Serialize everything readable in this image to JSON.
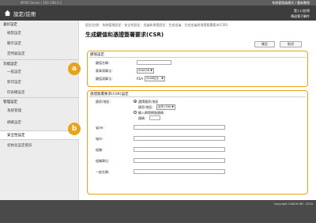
{
  "topbar": {
    "host": "MF00 Series / 192.168.0.1",
    "user": "系統管理員模式 / 重新整理"
  },
  "header": {
    "title": "設定/註冊",
    "logout": "登入口註冊",
    "mail": "傳送電子郵件"
  },
  "sidebar": {
    "items": [
      {
        "label": "喜好設定"
      },
      {
        "label": "紙張設定"
      },
      {
        "label": "顯示設定"
      },
      {
        "label": "定時器設定"
      },
      {
        "label": "功能設定"
      },
      {
        "label": "一般設定"
      },
      {
        "label": "影印設定"
      },
      {
        "label": "印表機設定"
      },
      {
        "label": "管理設定"
      },
      {
        "label": "系統管理"
      },
      {
        "label": "網路設定"
      },
      {
        "label": "安全性設定"
      },
      {
        "label": "初始化設定資訊"
      }
    ]
  },
  "main": {
    "breadcrumb": "設定/註冊：系統管理設定：安全性設定：金鑰和憑證設定：生成金鑰：生成金鑰與憑證簽署要求(CSR)",
    "title": "生成鍵值和憑證簽署要求(CSR)",
    "ok_label": "確定",
    "cancel_label": "取消"
  },
  "key_section": {
    "title": "鍵值設定",
    "name_label": "鍵值名稱：",
    "signature_label": "簽章演算法：",
    "signature_value": "SHA256",
    "key_alg_label": "鍵值演算法：",
    "key_alg_prefix": "RSA",
    "key_alg_value": "2048位元"
  },
  "csr_section": {
    "title": "憑證簽署要求(CSR)設定",
    "country_label": "國家/地區：",
    "radio_select_label": "選擇國家/地區",
    "country_field_label": "國家/地區：",
    "country_value": "台灣 (TW)",
    "radio_input_label": "輸入網際網路國碼：",
    "code_label": "國碼：",
    "state_label": "省/州：",
    "city_label": "城市：",
    "org_label": "組織：",
    "unit_label": "組織單位：",
    "common_label": "一般名稱："
  },
  "callouts": {
    "a": "a",
    "b": "b"
  },
  "footer": {
    "copyright": "Copyright CANON INC. 2016"
  }
}
